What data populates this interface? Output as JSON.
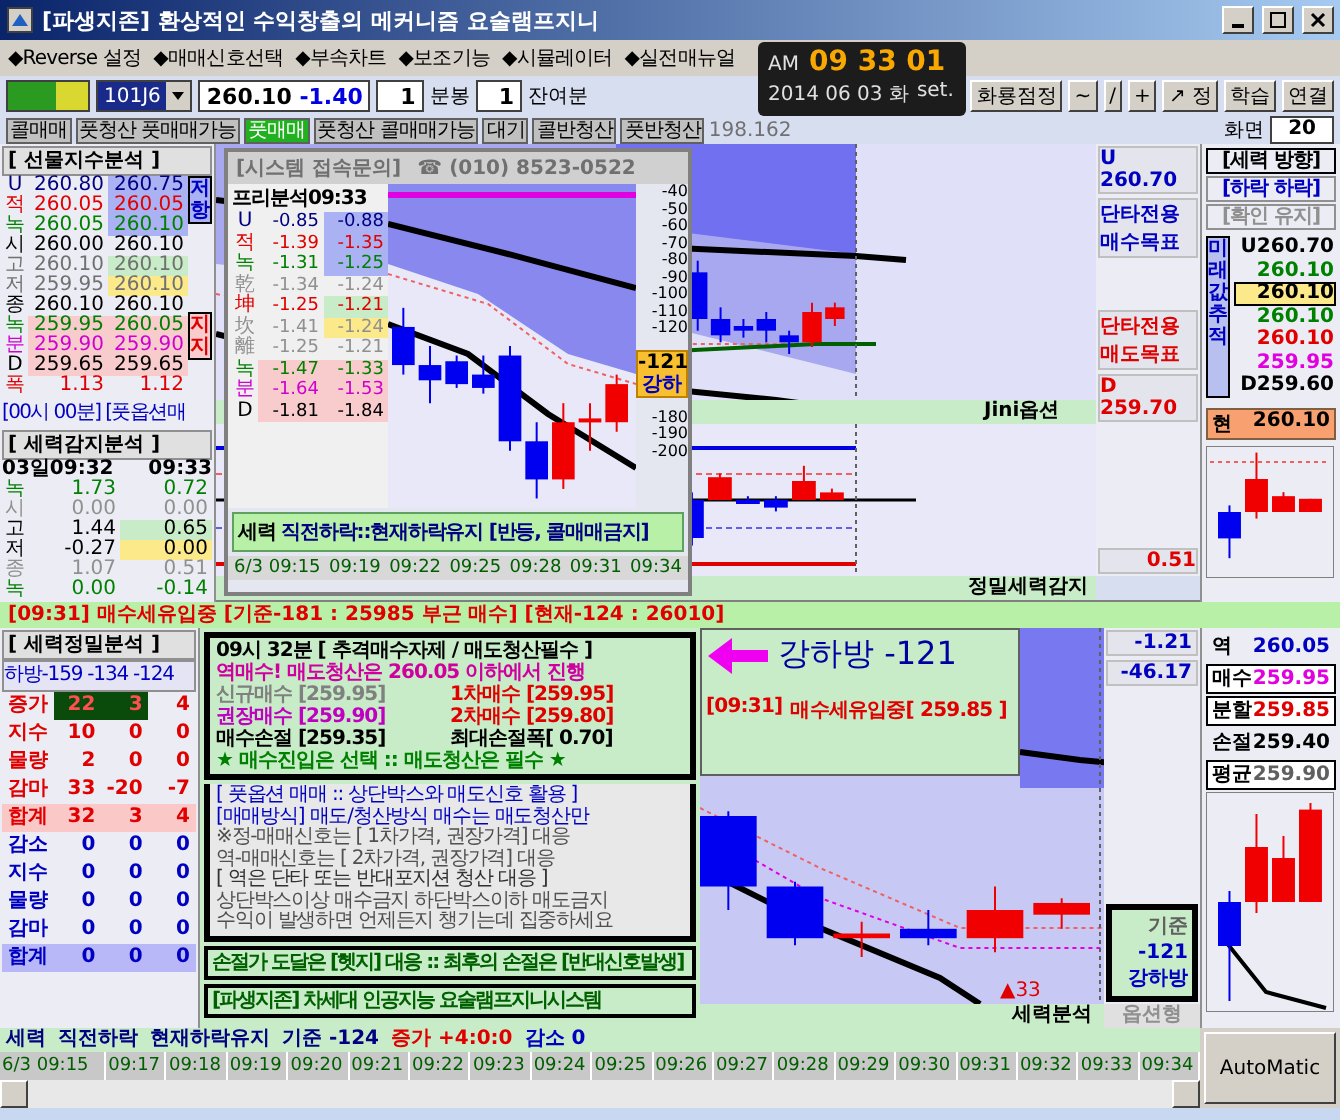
{
  "window": {
    "title": "[파생지존] 환상적인 수익창출의 메커니즘 요술램프지니"
  },
  "menu": [
    "◆Reverse 설정",
    "◆매매신호선택",
    "◆부속차트",
    "◆보조기능",
    "◆시뮬레이터",
    "◆실전매뉴얼"
  ],
  "clock": {
    "ampm": "AM",
    "time": "09 33 01",
    "date": "2014 06 03 화",
    "set": "set."
  },
  "toolbar": {
    "code": "101J6",
    "price": "260.10",
    "change": "-1.40",
    "period": "1",
    "period_unit": "분봉",
    "remain": "1",
    "remain_unit": "잔여분",
    "buttons": [
      "화룡점정",
      "~",
      "/",
      "+",
      "↗ 정",
      "학습",
      "연결"
    ]
  },
  "signal_tabs": [
    {
      "label": "콜매매",
      "selected": false
    },
    {
      "label": "풋청산 풋매매가능",
      "selected": false
    },
    {
      "label": "풋매매",
      "selected": true
    },
    {
      "label": "풋청산 콜매매가능",
      "selected": false
    },
    {
      "label": "대기",
      "selected": false
    },
    {
      "label": "콜반청산",
      "selected": false
    },
    {
      "label": "풋반청산",
      "selected": false
    }
  ],
  "signal_code": "198.162",
  "screen": {
    "label": "화면",
    "value": "20"
  },
  "futures_index": {
    "title": "[ 선물지수분석 ]",
    "resist_label": "저항",
    "support_label": "지지",
    "rows": [
      {
        "label": "U",
        "a": "260.80",
        "b": "260.75",
        "color": "#000080",
        "kind": "resist"
      },
      {
        "label": "적",
        "a": "260.05",
        "b": "260.05",
        "color": "#e00000",
        "kind": "resist"
      },
      {
        "label": "녹",
        "a": "260.05",
        "b": "260.10",
        "color": "#008000",
        "kind": "resist"
      },
      {
        "label": "시",
        "a": "260.00",
        "b": "260.10",
        "color": "#000000",
        "kind": "plain"
      },
      {
        "label": "고",
        "a": "260.10",
        "b": "260.10",
        "color": "#707070",
        "kind": "high"
      },
      {
        "label": "저",
        "a": "259.95",
        "b": "260.10",
        "color": "#707070",
        "kind": "low"
      },
      {
        "label": "종",
        "a": "260.10",
        "b": "260.10",
        "color": "#000000",
        "kind": "plain"
      },
      {
        "label": "녹",
        "a": "259.95",
        "b": "260.05",
        "color": "#008000",
        "kind": "support"
      },
      {
        "label": "분",
        "a": "259.90",
        "b": "259.90",
        "color": "#d000d0",
        "kind": "support"
      },
      {
        "label": "D",
        "a": "259.65",
        "b": "259.65",
        "color": "#000000",
        "kind": "support"
      },
      {
        "label": "폭",
        "a": "1.13",
        "b": "1.12",
        "color": "#e00000",
        "kind": "plain"
      }
    ]
  },
  "time_note": "[00시 00분] [풋옵션매",
  "force_detect": {
    "title": "[ 세력감지분석 ]",
    "head_a": "03일09:32",
    "head_b": "09:33",
    "rows": [
      {
        "label": "녹",
        "a": "1.73",
        "b": "0.72",
        "color": "#008000",
        "kind": "plain"
      },
      {
        "label": "시",
        "a": "0.00",
        "b": "0.00",
        "color": "#909090",
        "kind": "plain"
      },
      {
        "label": "고",
        "a": "1.44",
        "b": "0.65",
        "color": "#000000",
        "kind": "high"
      },
      {
        "label": "저",
        "a": "-0.27",
        "b": "0.00",
        "color": "#000000",
        "kind": "low"
      },
      {
        "label": "종",
        "a": "1.07",
        "b": "0.51",
        "color": "#909090",
        "kind": "plain"
      },
      {
        "label": "녹",
        "a": "0.00",
        "b": "-0.14",
        "color": "#008000",
        "kind": "plain"
      }
    ]
  },
  "popup": {
    "title": "[시스템 접속문의]",
    "phone": "☎ (010) 8523-0522",
    "table_title": "프리분석09:33",
    "rows": [
      {
        "label": "U",
        "a": "-0.85",
        "b": "-0.88",
        "color": "#000080",
        "kind": "resist"
      },
      {
        "label": "적",
        "a": "-1.39",
        "b": "-1.35",
        "color": "#e00000",
        "kind": "resist"
      },
      {
        "label": "녹",
        "a": "-1.31",
        "b": "-1.25",
        "color": "#008000",
        "kind": "resist"
      },
      {
        "label": "乾",
        "a": "-1.34",
        "b": "-1.24",
        "color": "#909090",
        "kind": "plain"
      },
      {
        "label": "坤",
        "a": "-1.25",
        "b": "-1.21",
        "color": "#e00000",
        "kind": "high"
      },
      {
        "label": "坎",
        "a": "-1.41",
        "b": "-1.24",
        "color": "#909090",
        "kind": "low"
      },
      {
        "label": "離",
        "a": "-1.25",
        "b": "-1.21",
        "color": "#909090",
        "kind": "plain"
      },
      {
        "label": "녹",
        "a": "-1.47",
        "b": "-1.33",
        "color": "#008000",
        "kind": "support"
      },
      {
        "label": "분",
        "a": "-1.64",
        "b": "-1.53",
        "color": "#d000d0",
        "kind": "support"
      },
      {
        "label": "D",
        "a": "-1.81",
        "b": "-1.84",
        "color": "#000000",
        "kind": "support"
      }
    ],
    "y_labels": [
      "-40",
      "-50",
      "-60",
      "-70",
      "-80",
      "-90",
      "-100",
      "-110",
      "-120"
    ],
    "y_labels_low": [
      "-180",
      "-190",
      "-200"
    ],
    "marker_value": "-121",
    "marker_label": "강하",
    "message": "**세력** 직전하락::현재하락유지 [반등, 콜매매금지]",
    "times": [
      "6/3 09:15",
      "09:19",
      "09:22",
      "09:25",
      "09:28",
      "09:31",
      "09:34"
    ]
  },
  "main_chart": {
    "upper_label": "U 260.70",
    "buy_target": "단타전용 매수목표",
    "sell_target": "단타전용 매도목표",
    "lower_label": "D 259.70",
    "band_label": "Jini옵션",
    "sub_value": "0.51",
    "sub_band_label": "정밀세력감지"
  },
  "direction": {
    "title": "[세력 방향]",
    "state": "[하락 하락]",
    "confirm": "[확인 유지]",
    "vertical_label": "미래값추적",
    "values": [
      {
        "text": "U260.70",
        "color": "#000000",
        "kind": "plain"
      },
      {
        "text": "260.10",
        "color": "#008000",
        "kind": "plain"
      },
      {
        "text": "260.10",
        "color": "#000000",
        "kind": "low"
      },
      {
        "text": "260.10",
        "color": "#008000",
        "kind": "plain"
      },
      {
        "text": "260.10",
        "color": "#e00000",
        "kind": "plain"
      },
      {
        "text": "259.95",
        "color": "#e000e0",
        "kind": "plain"
      },
      {
        "text": "D259.60",
        "color": "#000000",
        "kind": "plain"
      }
    ],
    "current_label": "현",
    "current": "260.10"
  },
  "banner": "[09:31] 매수세유입중 [기준-181 : 25985 부근 매수] [현재-124 : 26010]",
  "precision": {
    "title": "[ 세력정밀분석 ]",
    "head": "하방-159 -134 -124",
    "rows": [
      {
        "label": "증가",
        "a": "22",
        "b": "3",
        "c": "4",
        "color": "#e00000",
        "kind": "head"
      },
      {
        "label": "지수",
        "a": "10",
        "b": "0",
        "c": "0",
        "color": "#e00000",
        "kind": "plain"
      },
      {
        "label": "물량",
        "a": "2",
        "b": "0",
        "c": "0",
        "color": "#e00000",
        "kind": "plain"
      },
      {
        "label": "감마",
        "a": "33",
        "b": "-20",
        "c": "-7",
        "color": "#e00000",
        "kind": "plain"
      },
      {
        "label": "합계",
        "a": "32",
        "b": "3",
        "c": "4",
        "color": "#e00000",
        "kind": "sum"
      },
      {
        "label": "감소",
        "a": "0",
        "b": "0",
        "c": "0",
        "color": "#0000c0",
        "kind": "plain"
      },
      {
        "label": "지수",
        "a": "0",
        "b": "0",
        "c": "0",
        "color": "#0000c0",
        "kind": "plain"
      },
      {
        "label": "물량",
        "a": "0",
        "b": "0",
        "c": "0",
        "color": "#0000c0",
        "kind": "plain"
      },
      {
        "label": "감마",
        "a": "0",
        "b": "0",
        "c": "0",
        "color": "#0000c0",
        "kind": "plain"
      },
      {
        "label": "합계",
        "a": "0",
        "b": "0",
        "c": "0",
        "color": "#0000c0",
        "kind": "total"
      }
    ]
  },
  "advice": {
    "lines": [
      {
        "text": "09시 32분 [ 추격매수자제 / 매도청산필수 ]",
        "color": "#000000"
      },
      {
        "text": "역매수! 매도청산은 260.05 이하에서 진행",
        "color": "#d000a0"
      }
    ],
    "prices": [
      {
        "text": "신규매수 [259.95]",
        "color": "#808080"
      },
      {
        "text": "1차매수 [259.95]",
        "color": "#e00000"
      },
      {
        "text": "권장매수 [259.90]",
        "color": "#c000c0"
      },
      {
        "text": "2차매수 [259.80]",
        "color": "#e00000"
      },
      {
        "text": "매수손절 [259.35]",
        "color": "#000000"
      },
      {
        "text": "최대손절폭[ 0.70]",
        "color": "#000000"
      }
    ],
    "footer": "★ 매수진입은 선택 :: 매도청산은 필수 ★"
  },
  "guide": [
    {
      "text": "[ 풋옵션 매매 :: 상단박스와 매도신호 활용 ]",
      "color": "#0000c0"
    },
    {
      "text": "[매매방식] 매도/청산방식 매수는 매도청산만",
      "color": "#0000c0"
    },
    {
      "text": "※정-매매신호는 [ 1차가격, 권장가격] 대응",
      "color": "#505050"
    },
    {
      "text": "역-매매신호는 [ 2차가격, 권장가격] 대응",
      "color": "#505050"
    },
    {
      "text": "[ 역은 단타 또는 반대포지션 청산 대응 ]",
      "color": "#303030"
    },
    {
      "text": "상단박스이상 매수금지 하단박스이하 매도금지",
      "color": "#505050"
    },
    {
      "text": "수익이 발생하면 언제든지 챙기는데 집중하세요",
      "color": "#505050"
    }
  ],
  "stop_note": "손절가 도달은 [헷지] 대응 :: 최후의 손절은 [반대신호발생]",
  "brand_note": "[파생지존] 차세대 인공지능 요술램프지니시스템",
  "callout": {
    "title": "강하방 -121",
    "time": "[09:31]",
    "status": "매수세유입중[ 259.85 ]"
  },
  "lower_chart": {
    "value_a": "-1.21",
    "value_b": "-46.17",
    "base_label": "기준",
    "base_value": "-121",
    "base_state": "강하방",
    "marker": "▲33",
    "band_label": "세력분석",
    "band_label_2": "옵션형"
  },
  "orders": [
    {
      "label": "역",
      "value": "260.05",
      "color": "#0000c0",
      "boxed": false
    },
    {
      "label": "매수",
      "value": "259.95",
      "color": "#e000e0",
      "boxed": true
    },
    {
      "label": "분할",
      "value": "259.85",
      "color": "#e00000",
      "boxed": true
    },
    {
      "label": "손절",
      "value": "259.40",
      "color": "#000000",
      "boxed": false
    },
    {
      "label": "평균",
      "value": "259.90",
      "color": "#606060",
      "boxed": true
    }
  ],
  "status_bar": [
    {
      "text": "세력",
      "color": "#000080"
    },
    {
      "text": "직전하락",
      "color": "#000080"
    },
    {
      "text": "현재하락유지",
      "color": "#000080"
    },
    {
      "text": "기준 -124",
      "color": "#000080"
    },
    {
      "text": "증가 +4:0:0",
      "color": "#e00000"
    },
    {
      "text": "감소 0",
      "color": "#0000c0"
    }
  ],
  "times": [
    "6/3 09:15",
    "09:17",
    "09:18",
    "09:19",
    "09:20",
    "09:21",
    "09:22",
    "09:23",
    "09:24",
    "09:25",
    "09:26",
    "09:27",
    "09:28",
    "09:29",
    "09:30",
    "09:31",
    "09:32",
    "09:33",
    "09:34"
  ],
  "auto_button": "AutoMatic"
}
